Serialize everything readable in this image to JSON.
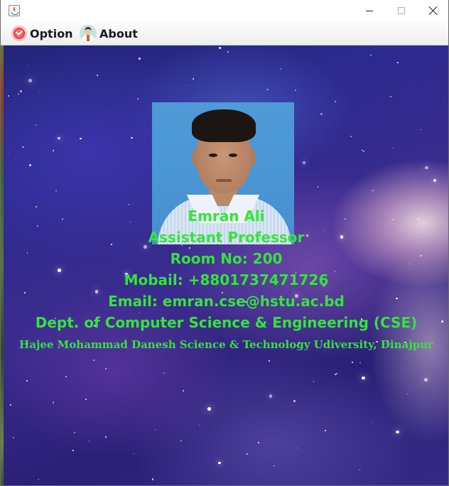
{
  "titlebar": {
    "app_icon": "java-cup-icon",
    "controls": {
      "minimize": "minimize-icon",
      "maximize": "maximize-icon",
      "close": "close-icon"
    }
  },
  "menubar": {
    "items": [
      {
        "label": "Option",
        "icon": "checkmark-badge-icon"
      },
      {
        "label": "About",
        "icon": "person-avatar-icon"
      }
    ]
  },
  "profile": {
    "photo": "profile-photo",
    "name": "Emran Ali",
    "title": "Assistant Professor",
    "room": "Room No: 200",
    "phone": "Mobail: +8801737471726",
    "email": "Email: emran.cse@hstu.ac.bd",
    "department": "Dept. of Computer Science & Engineering (CSE)",
    "university": "Hajee Mohammad Danesh Science & Technology Udiversity, Dinajpur"
  },
  "colors": {
    "text_accent": "#33e53a",
    "background_space": "#2d2a8f",
    "menubar": "#eeeeee"
  }
}
